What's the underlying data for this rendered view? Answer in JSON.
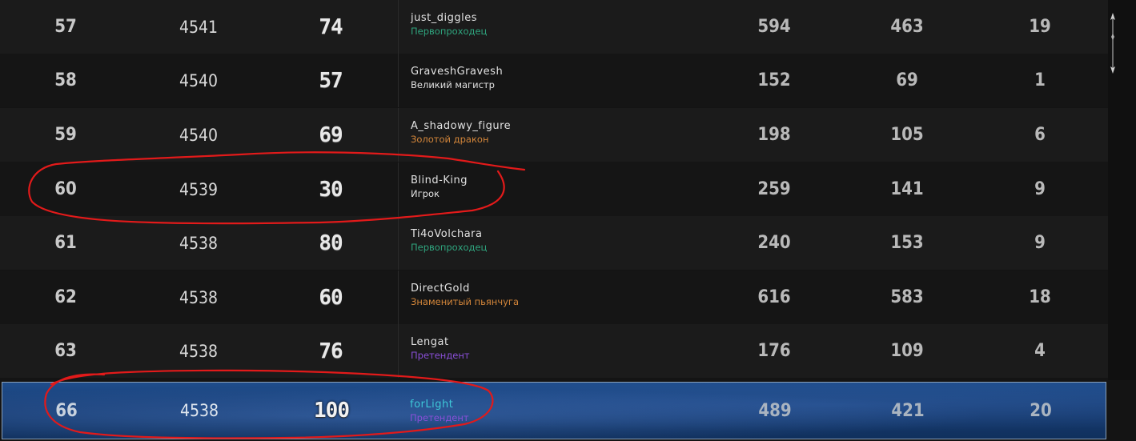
{
  "leaderboard": {
    "rows": [
      {
        "place": "57",
        "rating": "4541",
        "level": "74",
        "name": "just_diggles",
        "title": "Первопроходец",
        "title_color": "#2fa57e",
        "stat1": "594",
        "stat2": "463",
        "stat3": "19"
      },
      {
        "place": "58",
        "rating": "4540",
        "level": "57",
        "name": "GraveshGravesh",
        "title": "Великий магистр",
        "title_color": "#e0e0e0",
        "stat1": "152",
        "stat2": "69",
        "stat3": "1"
      },
      {
        "place": "59",
        "rating": "4540",
        "level": "69",
        "name": "A_shadowy_figure",
        "title": "Золотой дракон",
        "title_color": "#d4863a",
        "stat1": "198",
        "stat2": "105",
        "stat3": "6"
      },
      {
        "place": "60",
        "rating": "4539",
        "level": "30",
        "name": "Blind-King",
        "title": "Игрок",
        "title_color": "#e0e0e0",
        "stat1": "259",
        "stat2": "141",
        "stat3": "9"
      },
      {
        "place": "61",
        "rating": "4538",
        "level": "80",
        "name": "Ti4oVolchara",
        "title": "Первопроходец",
        "title_color": "#2fa57e",
        "stat1": "240",
        "stat2": "153",
        "stat3": "9"
      },
      {
        "place": "62",
        "rating": "4538",
        "level": "60",
        "name": "DirectGold",
        "title": "Знаменитый пьянчуга",
        "title_color": "#d4863a",
        "stat1": "616",
        "stat2": "583",
        "stat3": "18"
      },
      {
        "place": "63",
        "rating": "4538",
        "level": "76",
        "name": "Lengat",
        "title": "Претендент",
        "title_color": "#8a4fd8",
        "stat1": "176",
        "stat2": "109",
        "stat3": "4"
      }
    ],
    "current_player": {
      "place": "66",
      "rating": "4538",
      "level": "100",
      "name": "forLight",
      "title": "Претендент",
      "title_color": "#8a4fd8",
      "stat1": "489",
      "stat2": "421",
      "stat3": "20"
    }
  },
  "colors": {
    "annotation": "#e21a1a",
    "highlight_row": "#173c72"
  }
}
